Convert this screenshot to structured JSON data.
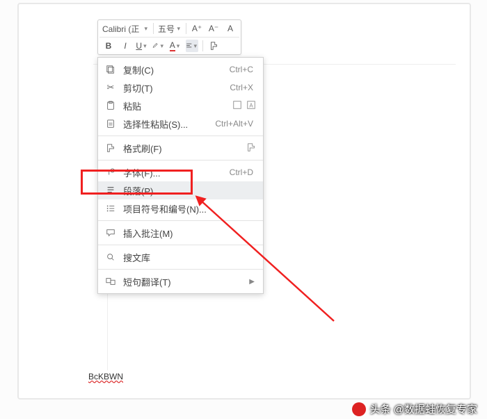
{
  "toolbar": {
    "font_name": "Calibri (正",
    "font_size": "五号",
    "inc_font": "A⁺",
    "dec_font": "A⁻",
    "case_btn": "A"
  },
  "menu": {
    "copy": {
      "label": "复制(C)",
      "shortcut": "Ctrl+C"
    },
    "cut": {
      "label": "剪切(T)",
      "shortcut": "Ctrl+X"
    },
    "paste": {
      "label": "粘贴"
    },
    "paste_special": {
      "label": "选择性粘贴(S)...",
      "shortcut": "Ctrl+Alt+V"
    },
    "format_painter": {
      "label": "格式刷(F)"
    },
    "font": {
      "label": "字体(F)...",
      "shortcut": "Ctrl+D"
    },
    "paragraph": {
      "label": "段落(P)..."
    },
    "bullets": {
      "label": "项目符号和编号(N)..."
    },
    "comment": {
      "label": "插入批注(M)"
    },
    "library": {
      "label": "搜文库"
    },
    "translate": {
      "label": "短句翻译(T)"
    }
  },
  "watermark": "BcKBWN",
  "attribution": "头条 @数据蛙恢复专家"
}
